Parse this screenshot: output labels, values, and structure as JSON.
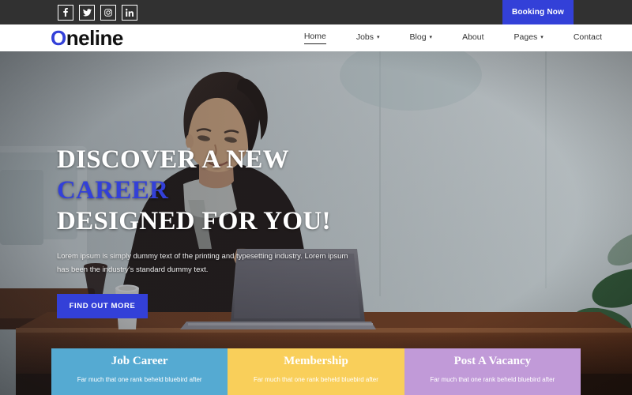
{
  "topbar": {
    "social": [
      {
        "name": "facebook-icon",
        "label": "Facebook"
      },
      {
        "name": "twitter-icon",
        "label": "Twitter"
      },
      {
        "name": "instagram-icon",
        "label": "Instagram"
      },
      {
        "name": "linkedin-icon",
        "label": "LinkedIn"
      }
    ],
    "booking_label": "Booking Now",
    "background": "#313131",
    "accent": "#3340d8"
  },
  "navbar": {
    "logo_first": "O",
    "logo_rest": "neline",
    "logo_accent": "#3340d8",
    "links": [
      {
        "label": "Home",
        "has_caret": false,
        "active": true
      },
      {
        "label": "Jobs",
        "has_caret": true,
        "active": false
      },
      {
        "label": "Blog",
        "has_caret": true,
        "active": false
      },
      {
        "label": "About",
        "has_caret": false,
        "active": false
      },
      {
        "label": "Pages",
        "has_caret": true,
        "active": false
      },
      {
        "label": "Contact",
        "has_caret": false,
        "active": false
      }
    ],
    "caret_glyph": "▾"
  },
  "hero": {
    "title_line1_plain": "DISCOVER A NEW ",
    "title_line1_accent": "CAREER",
    "title_line2": "DESIGNED FOR YOU!",
    "paragraph": "Lorem ipsum is simply dummy text of the printing and typesetting industry. Lorem ipsum has been the industry's standard dummy text.",
    "button_label": "FIND OUT MORE",
    "accent_color": "#3340d8"
  },
  "cards": [
    {
      "title": "Job Career",
      "desc": "Far much that one rank beheld bluebird after",
      "color": "#55aad2"
    },
    {
      "title": "Membership",
      "desc": "Far much that one rank beheld bluebird after",
      "color": "#f9cf5a"
    },
    {
      "title": "Post A Vacancy",
      "desc": "Far much that one rank beheld bluebird after",
      "color": "#c19ad8"
    }
  ]
}
